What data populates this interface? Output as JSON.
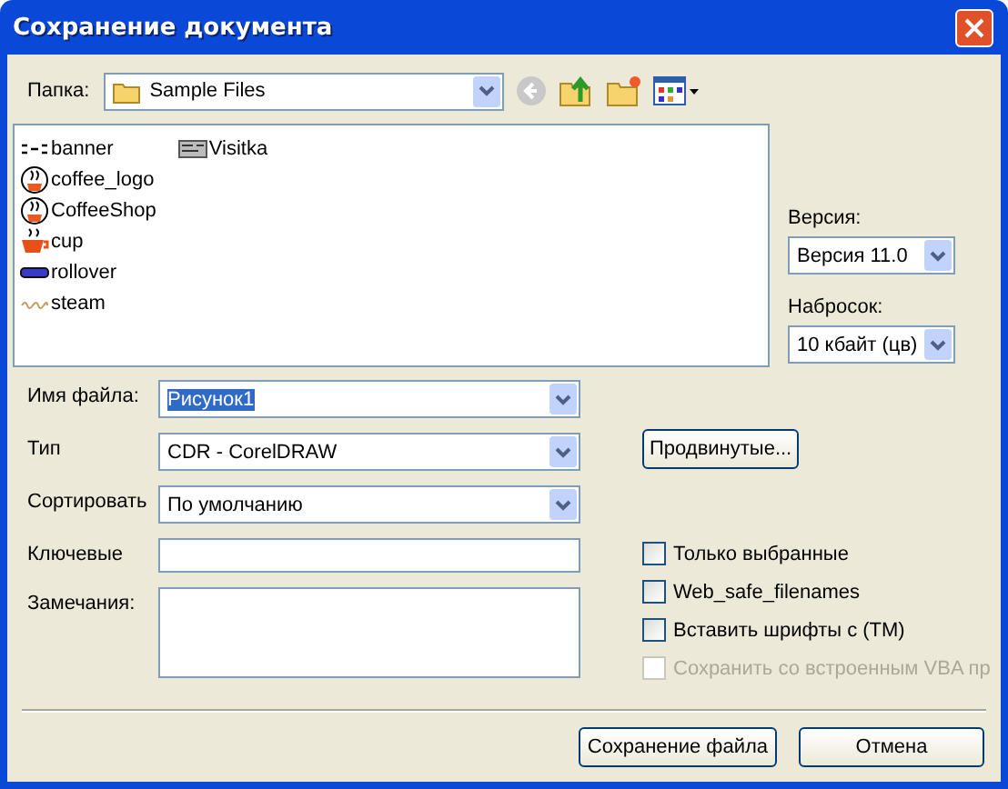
{
  "window": {
    "title": "Сохранение документа"
  },
  "folder": {
    "label": "Папка:",
    "value": "Sample Files"
  },
  "files": [
    {
      "name": "banner",
      "kind": "banner"
    },
    {
      "name": "coffee_logo",
      "kind": "logo"
    },
    {
      "name": "CoffeeShop",
      "kind": "logo"
    },
    {
      "name": "cup",
      "kind": "cup"
    },
    {
      "name": "rollover",
      "kind": "rollover"
    },
    {
      "name": "steam",
      "kind": "steam"
    },
    {
      "name": "Visitka",
      "kind": "card"
    }
  ],
  "version": {
    "label": "Версия:",
    "value": "Версия 11.0"
  },
  "thumbnail": {
    "label": "Набросок:",
    "value": "10 кбайт (цв)"
  },
  "form": [
    {
      "kind": "combo",
      "label": "Имя файла:",
      "value": "Рисунок1",
      "highlighted": true
    },
    {
      "kind": "combo",
      "label": "Тип",
      "value": "CDR - CorelDRAW",
      "highlighted": false
    },
    {
      "kind": "combo",
      "label": "Сортировать",
      "value": "По умолчанию",
      "highlighted": false
    },
    {
      "kind": "text",
      "label": "Ключевые"
    },
    {
      "kind": "area",
      "label": "Замечания:"
    }
  ],
  "advanced_button": "Продвинутые...",
  "options": [
    {
      "label": "Только выбранные",
      "checked": false,
      "disabled": false
    },
    {
      "label": "Web_safe_filenames",
      "checked": false,
      "disabled": false
    },
    {
      "label": "Вставить шрифты с (TM)",
      "checked": false,
      "disabled": false
    },
    {
      "label": "Сохранить со встроенным VBA пр",
      "checked": false,
      "disabled": true
    }
  ],
  "buttons": [
    "Сохранение файла",
    "Отмена"
  ]
}
